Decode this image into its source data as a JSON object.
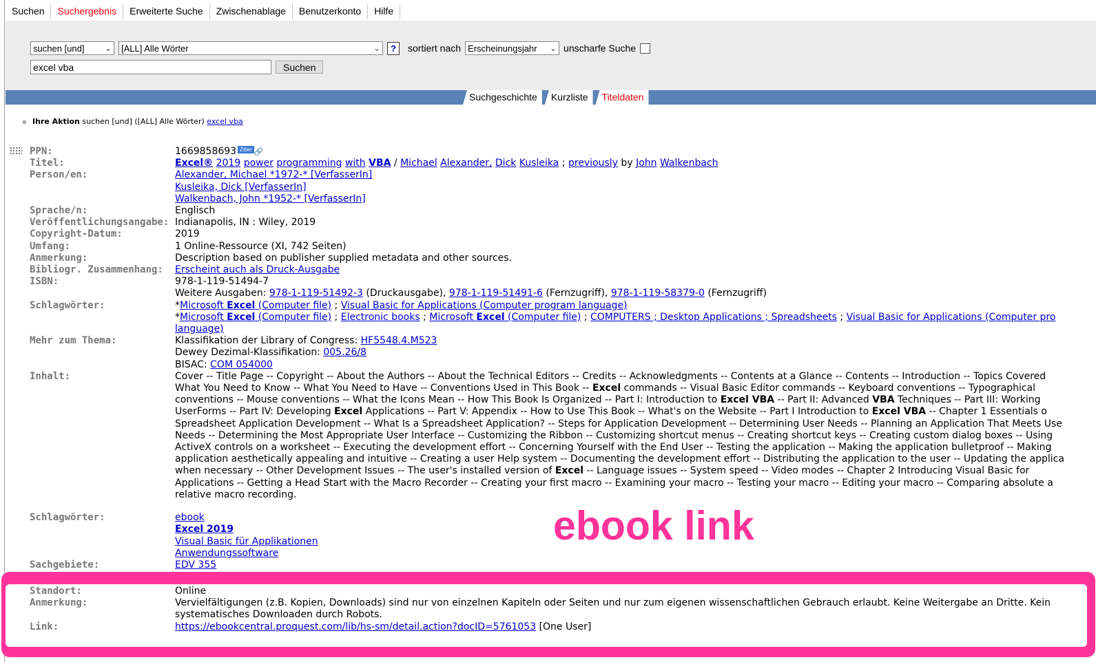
{
  "topnav": [
    {
      "label": "Suchen",
      "active": false
    },
    {
      "label": "Suchergebnis",
      "active": true
    },
    {
      "label": "Erweiterte Suche",
      "active": false
    },
    {
      "label": "Zwischenablage",
      "active": false
    },
    {
      "label": "Benutzerkonto",
      "active": false
    },
    {
      "label": "Hilfe",
      "active": false
    }
  ],
  "search": {
    "operator": "suchen [und]",
    "field": "[ALL] Alle Wörter",
    "help": "?",
    "sort_label": "sortiert nach",
    "sort_value": "Erscheinungsjahr",
    "fuzzy_label": "unscharfe Suche",
    "query": "excel vba",
    "button": "Suchen"
  },
  "subtabs": [
    "Suchgeschichte",
    "Kurzliste",
    "Titeldaten"
  ],
  "action": {
    "label": "Ihre Aktion",
    "text": "suchen [und] ([ALL] Alle Wörter)",
    "query": "excel vba"
  },
  "record": {
    "ppn_label": "PPN:",
    "ppn": "1669858693",
    "zitier": "Zitier",
    "titel_label": "Titel:",
    "title_words": [
      "Excel®",
      "2019",
      "power",
      "programming",
      "with",
      "VBA"
    ],
    "title_sep": " / ",
    "title_authors": [
      "Michael",
      "Alexander,",
      "Dick",
      "Kusleika"
    ],
    "title_prev": " ; ",
    "title_prev_link": "previously",
    "title_by": " by ",
    "title_by_authors": [
      "John",
      "Walkenbach"
    ],
    "person_label": "Person/en:",
    "persons": [
      "Alexander, Michael *1972-* [VerfasserIn]",
      "Kusleika, Dick [VerfasserIn]",
      "Walkenbach, John *1952-* [VerfasserIn]"
    ],
    "sprache_label": "Sprache/n:",
    "sprache": "Englisch",
    "veroeff_label": "Veröffentlichungsangabe:",
    "veroeff": "Indianapolis, IN : Wiley, 2019",
    "copyright_label": "Copyright-Datum:",
    "copyright": "2019",
    "umfang_label": "Umfang:",
    "umfang": "1 Online-Ressource (XI, 742 Seiten)",
    "anm_label": "Anmerkung:",
    "anm": "Description based on publisher supplied metadata and other sources.",
    "bib_label": "Bibliogr. Zusammenhang:",
    "bib": "Erscheint auch als Druck-Ausgabe",
    "isbn_label": "ISBN:",
    "isbn": "978-1-119-51494-7",
    "weitere_prefix": "Weitere Ausgaben: ",
    "weitere": [
      {
        "isbn": "978-1-119-51492-3",
        "note": " (Druckausgabe), "
      },
      {
        "isbn": "978-1-119-51491-6",
        "note": " (Fernzugriff), "
      },
      {
        "isbn": "978-1-119-58379-0",
        "note": " (Fernzugriff)"
      }
    ],
    "schlag_label": "Schlagwörter:",
    "schlag1": [
      "*",
      "Microsoft ",
      "Excel",
      " (Computer file)",
      " ; ",
      "Visual Basic for Applications (Computer program language)"
    ],
    "schlag2_parts": [
      "*",
      "Microsoft ",
      "Excel",
      " (Computer file)",
      " ; ",
      "Electronic books",
      " ; ",
      "Microsoft ",
      "Excel",
      " (Computer file)",
      " ; ",
      "COMPUTERS ; Desktop Applications ; Spreadsheets",
      " ; ",
      "Visual Basic for Applications (Computer pro"
    ],
    "schlag2_cont": "language)",
    "mehr_label": "Mehr zum Thema:",
    "lcc_prefix": "Klassifikation der Library of Congress: ",
    "lcc": "HF5548.4.M523",
    "ddc_prefix": "Dewey Dezimal-Klassifikation: ",
    "ddc": "005.26/8",
    "bisac_prefix": "BISAC: ",
    "bisac": "COM 054000",
    "inhalt_label": "Inhalt:",
    "inhalt_lines": [
      "Cover -- Title Page -- Copyright -- About the Authors -- About the Technical Editors -- Credits -- Acknowledgments -- Contents at a Glance -- Contents -- Introduction -- Topics Covered",
      "What You Need to Know -- What You Need to Have -- Conventions Used in This Book -- <b>Excel</b> commands -- Visual Basic Editor commands -- Keyboard conventions -- Typographical",
      "conventions -- Mouse conventions -- What the Icons Mean -- How This Book Is Organized -- Part I: Introduction to <b>Excel VBA</b> -- Part II: Advanced <b>VBA</b> Techniques -- Part III: Working",
      "UserForms -- Part IV: Developing <b>Excel</b> Applications -- Part V: Appendix -- How to Use This Book -- What's on the Website -- Part I Introduction to <b>Excel VBA</b> -- Chapter 1 Essentials o",
      "Spreadsheet Application Development -- What Is a Spreadsheet Application? -- Steps for Application Development -- Determining User Needs -- Planning an Application That Meets Use",
      "Needs -- Determining the Most Appropriate User Interface -- Customizing the Ribbon -- Customizing shortcut menus -- Creating shortcut keys -- Creating custom dialog boxes -- Using",
      "ActiveX controls on a worksheet -- Executing the development effort -- Concerning Yourself with the End User -- Testing the application -- Making the application bulletproof -- Making",
      "application aesthetically appealing and intuitive -- Creating a user Help system -- Documenting the development effort -- Distributing the application to the user -- Updating the applica",
      "when necessary -- Other Development Issues -- The user's installed version of <b>Excel</b> -- Language issues -- System speed -- Video modes -- Chapter 2 Introducing Visual Basic for",
      "Applications -- Getting a Head Start with the Macro Recorder -- Creating your first macro -- Examining your macro -- Testing your macro -- Editing your macro -- Comparing absolute a",
      "relative macro recording."
    ],
    "schlag2_label": "Schlagwörter:",
    "tags": [
      "ebook",
      "Excel 2019",
      "Visual Basic für Applikationen",
      "Anwendungssoftware"
    ],
    "sach_label": "Sachgebiete:",
    "sach": "EDV 355",
    "standort_label": "Standort:",
    "standort": "Online",
    "anm2_label": "Anmerkung:",
    "anm2_l1": "Vervielfältigungen (z.B. Kopien, Downloads) sind nur von einzelnen Kapiteln oder Seiten und nur zum eigenen wissenschaftlichen Gebrauch erlaubt. Keine Weitergabe an Dritte. Kein",
    "anm2_l2": "systematisches Downloaden durch Robots.",
    "link_label": "Link:",
    "link": "https://ebookcentral.proquest.com/lib/hs-sm/detail.action?docID=5761053",
    "link_note": " [One User]"
  },
  "annotation": {
    "text": "ebook link",
    "color": "#ff3399"
  }
}
